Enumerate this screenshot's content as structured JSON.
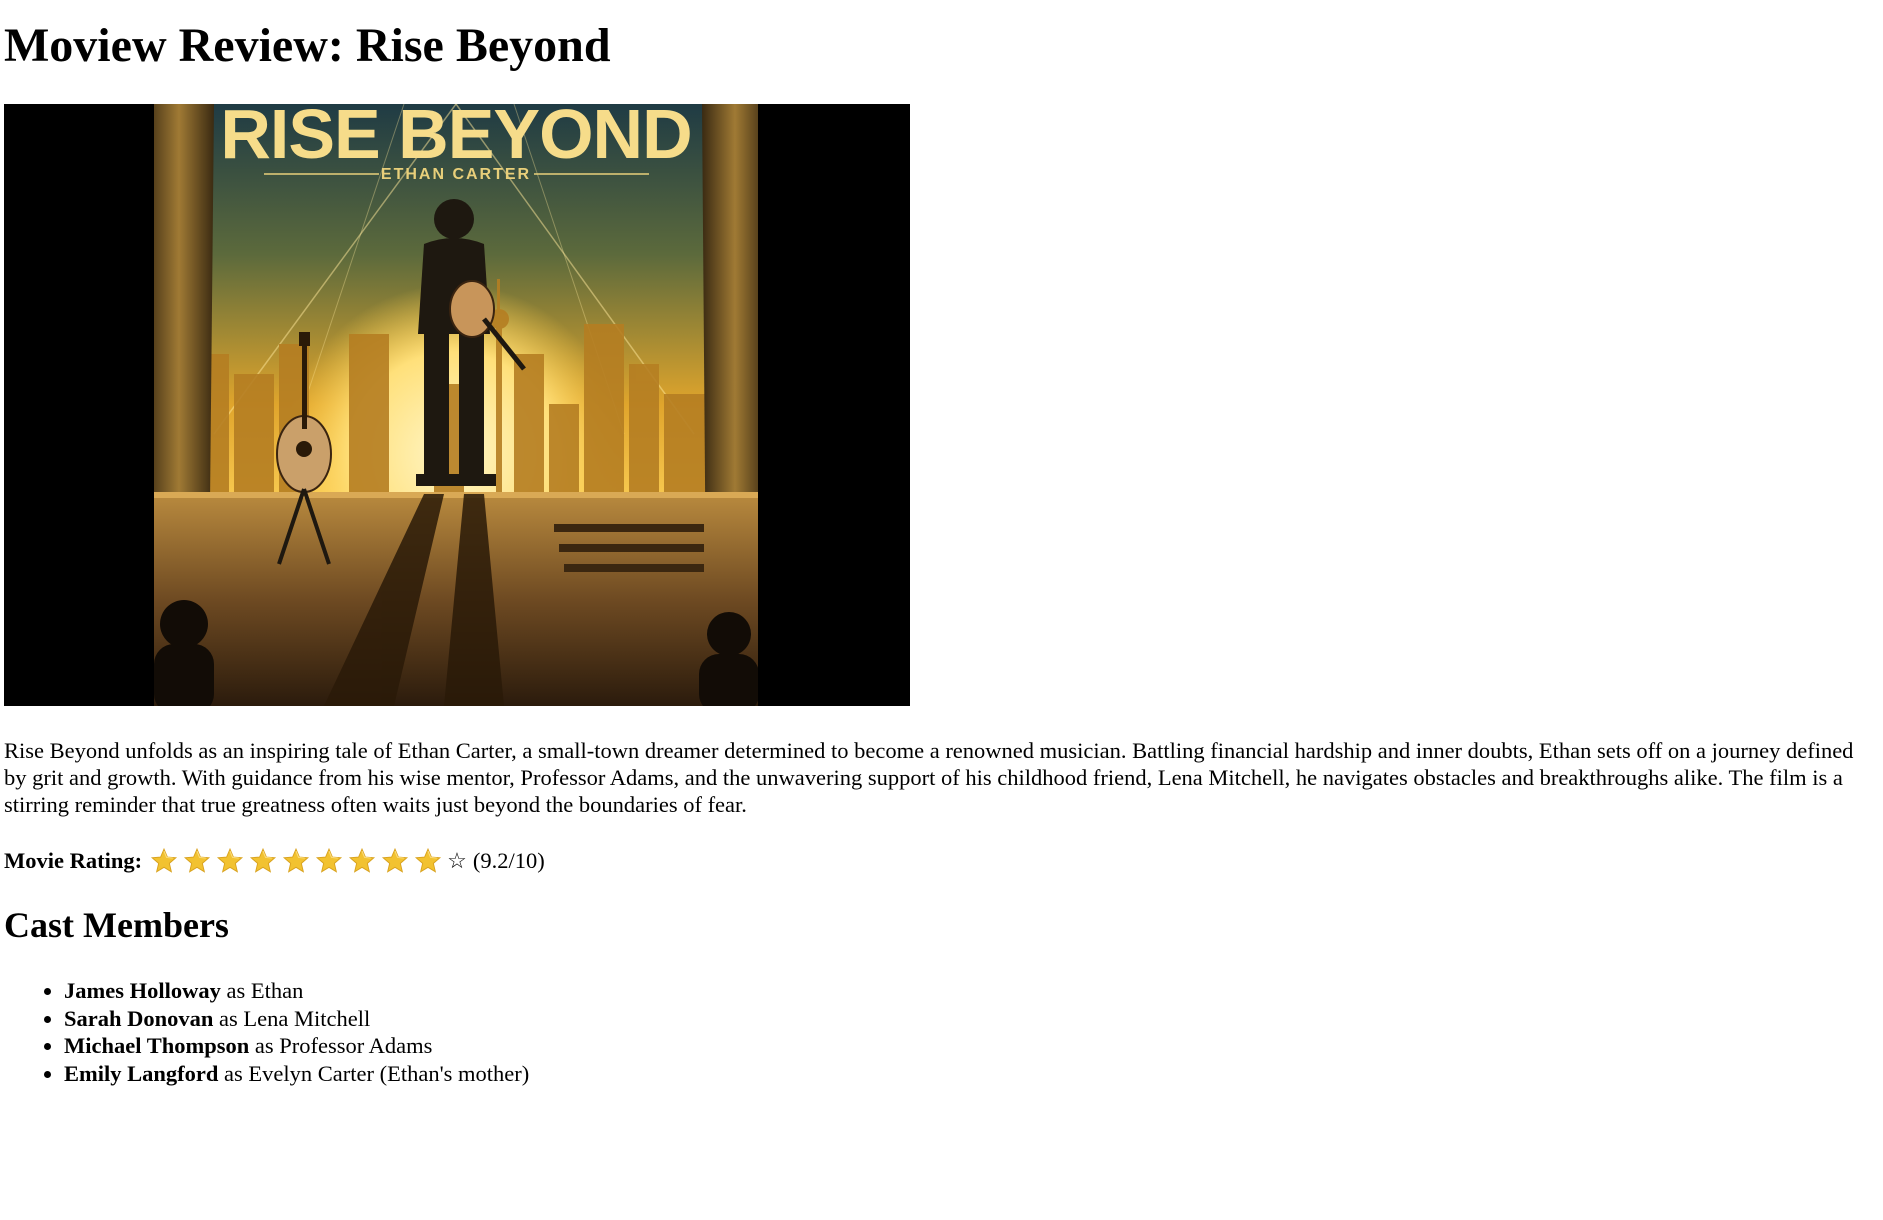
{
  "page": {
    "title": "Moview Review: Rise Beyond"
  },
  "poster": {
    "title_text": "RISE BEYOND",
    "byline_text": "ETHAN CARTER"
  },
  "summary": "Rise Beyond unfolds as an inspiring tale of Ethan Carter, a small-town dreamer determined to become a renowned musician. Battling financial hardship and inner doubts, Ethan sets off on a journey defined by grit and growth. With guidance from his wise mentor, Professor Adams, and the unwavering support of his childhood friend, Lena Mitchell, he navigates obstacles and breakthroughs alike. The film is a stirring reminder that true greatness often waits just beyond the boundaries of fear.",
  "rating": {
    "label": "Movie Rating:",
    "filled_stars": 9,
    "total_stars": 10,
    "empty_star_glyph": "☆",
    "score_text": "(9.2/10)",
    "star_color": "#f2c230"
  },
  "cast": {
    "heading": "Cast Members",
    "members": [
      {
        "actor": "James Holloway",
        "role": " as Ethan"
      },
      {
        "actor": "Sarah Donovan",
        "role": " as Lena Mitchell"
      },
      {
        "actor": "Michael Thompson",
        "role": " as Professor Adams"
      },
      {
        "actor": "Emily Langford",
        "role": " as Evelyn Carter (Ethan's mother)"
      }
    ]
  }
}
